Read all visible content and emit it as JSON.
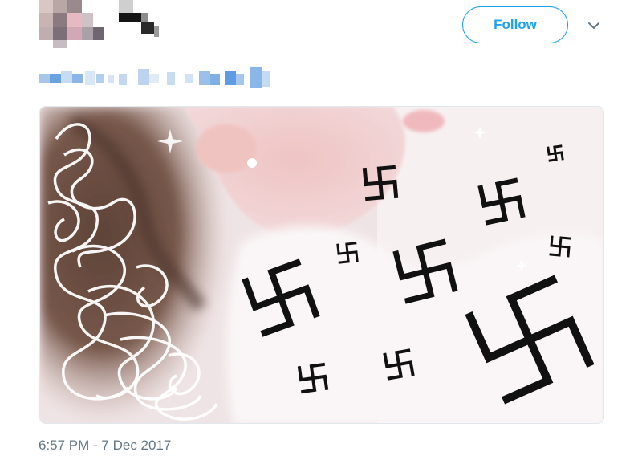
{
  "tweet": {
    "follow_label": "Follow",
    "timestamp": "6:57 PM - 7 Dec 2017"
  },
  "icons": {
    "more": "chevron-down-icon"
  },
  "colors": {
    "accent": "#1da1f2",
    "muted_text": "#657786",
    "border": "#e1e8ed"
  }
}
